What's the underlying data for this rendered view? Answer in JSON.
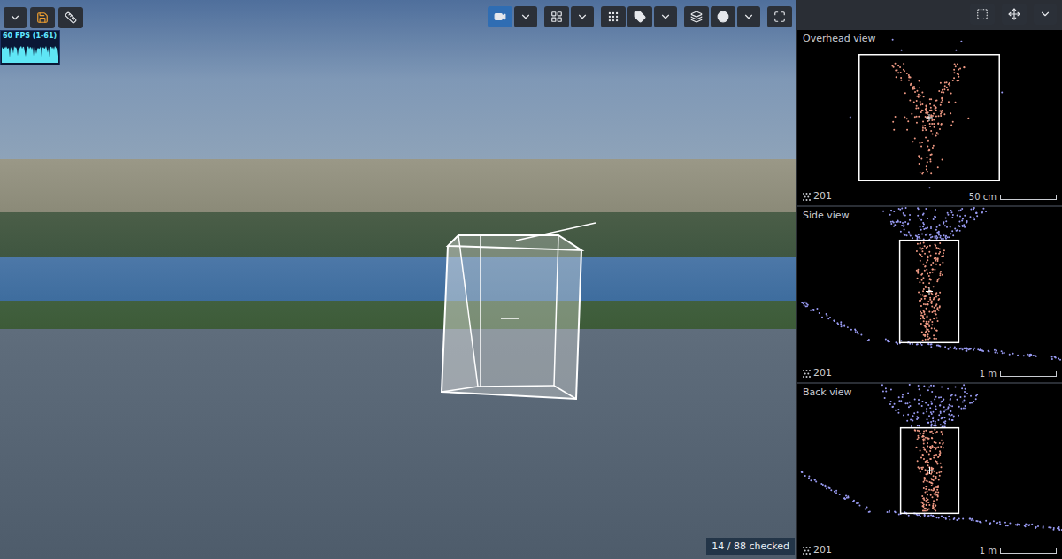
{
  "fps_meter": {
    "label": "60 FPS (1-61)"
  },
  "left_toolbar": [
    {
      "kind": "dropdown",
      "selected": false
    },
    {
      "kind": "save",
      "selected": false
    },
    {
      "kind": "ruler",
      "selected": false
    }
  ],
  "main_toolbar": [
    [
      {
        "kind": "camera",
        "selected": true
      },
      {
        "kind": "dropdown",
        "selected": false
      }
    ],
    [
      {
        "kind": "layout",
        "selected": false
      },
      {
        "kind": "dropdown",
        "selected": false
      }
    ],
    [
      {
        "kind": "points",
        "selected": false
      },
      {
        "kind": "tag",
        "selected": false
      },
      {
        "kind": "dropdown",
        "selected": false
      }
    ],
    [
      {
        "kind": "layers",
        "selected": false
      },
      {
        "kind": "circle",
        "selected": false
      },
      {
        "kind": "dropdown",
        "selected": false
      }
    ],
    [
      {
        "kind": "fullscreen",
        "selected": false
      }
    ]
  ],
  "status": "14 / 88 checked",
  "side_toolbar": [
    {
      "kind": "select",
      "selected": false
    },
    {
      "kind": "move",
      "selected": false
    },
    {
      "kind": "dropdown",
      "selected": false
    }
  ],
  "views": [
    {
      "title": "Overhead view",
      "kind": "overhead",
      "count": "201",
      "scale": "50 cm"
    },
    {
      "title": "Side view",
      "kind": "side",
      "count": "201",
      "scale": "1 m"
    },
    {
      "title": "Back view",
      "kind": "back",
      "count": "201",
      "scale": "1 m"
    }
  ]
}
